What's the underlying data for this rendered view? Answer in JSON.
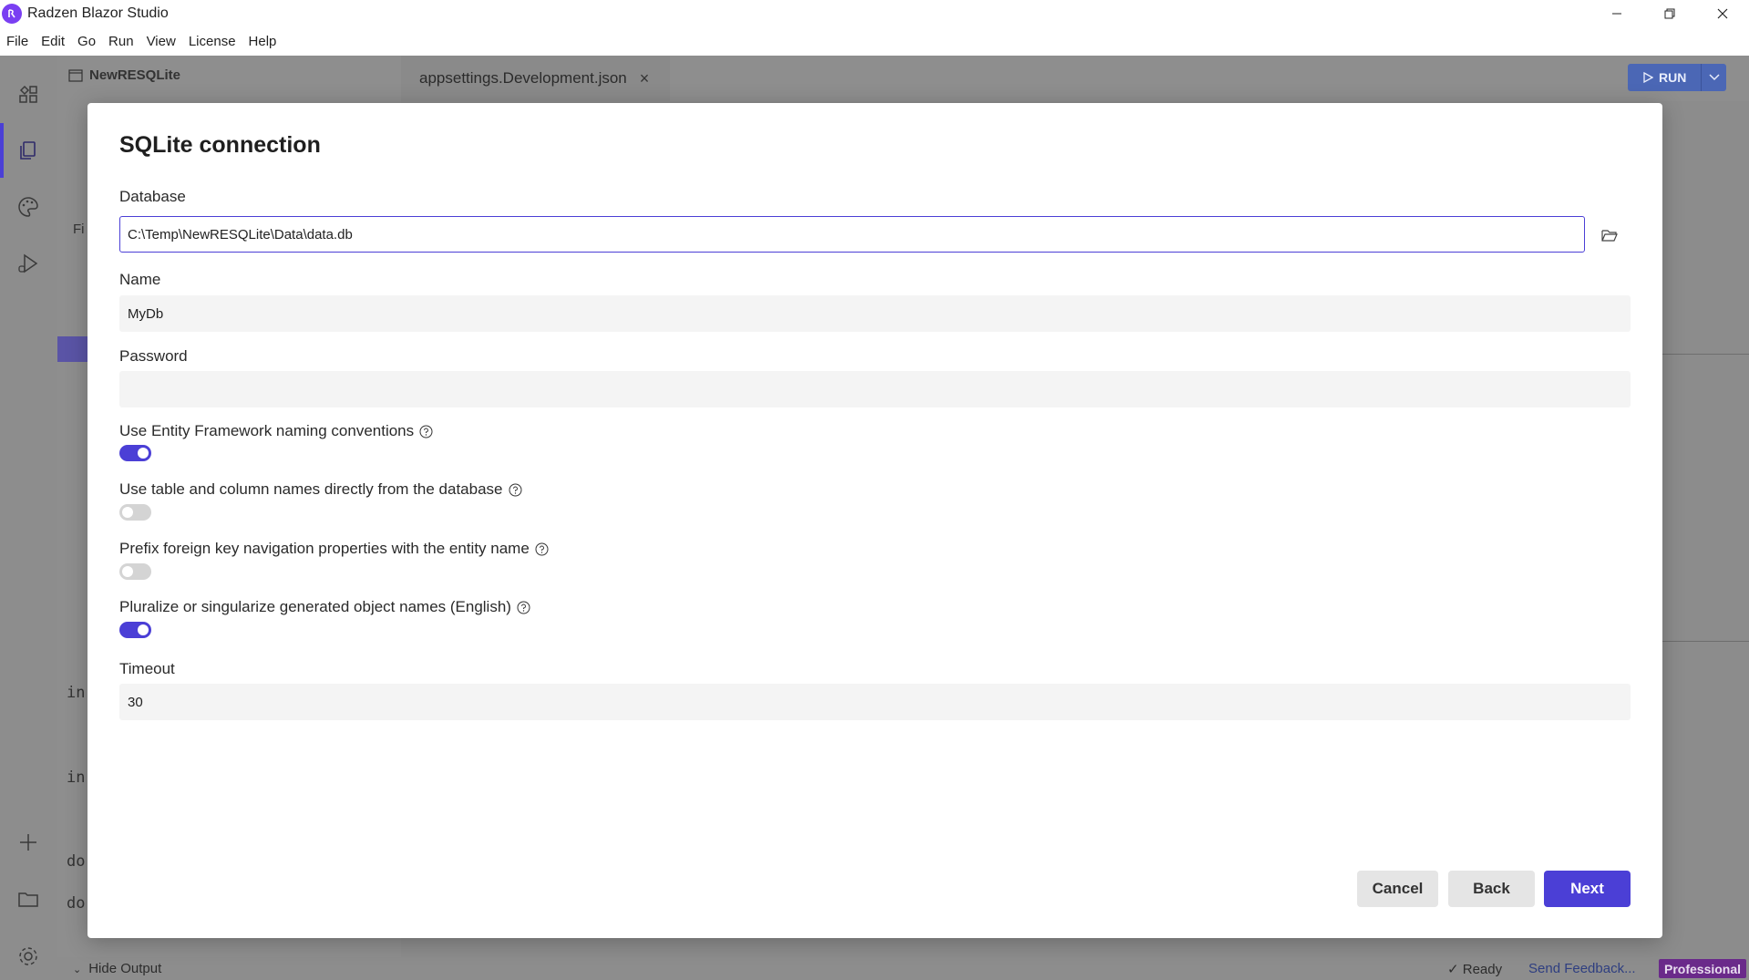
{
  "window": {
    "title": "Radzen Blazor Studio"
  },
  "menu": [
    "File",
    "Edit",
    "Go",
    "Run",
    "View",
    "License",
    "Help"
  ],
  "background": {
    "project_name": "NewRESQLite",
    "editor_tab": "appsettings.Development.json",
    "editor_tab_close": "×",
    "run_label": "RUN",
    "code_fragments": [
      "in",
      "in",
      "do",
      "do"
    ],
    "side_fragment": "Fi"
  },
  "dialog": {
    "title": "SQLite connection",
    "database": {
      "label": "Database",
      "value": "C:\\Temp\\NewRESQLite\\Data\\data.db"
    },
    "name": {
      "label": "Name",
      "value": "MyDb"
    },
    "password": {
      "label": "Password",
      "value": ""
    },
    "switches": [
      {
        "label": "Use Entity Framework naming conventions",
        "on": true
      },
      {
        "label": "Use table and column names directly from the database",
        "on": false
      },
      {
        "label": "Prefix foreign key navigation properties with the entity name",
        "on": false
      },
      {
        "label": "Pluralize or singularize generated object names (English)",
        "on": true
      }
    ],
    "timeout": {
      "label": "Timeout",
      "value": "30"
    },
    "buttons": {
      "cancel": "Cancel",
      "back": "Back",
      "next": "Next"
    }
  },
  "statusbar": {
    "hide_output": "Hide Output",
    "ready": "✓ Ready",
    "feedback": "Send Feedback...",
    "edition": "Professional"
  },
  "colors": {
    "accent": "#4b3fd6",
    "run_button": "#4b67b5",
    "edition_badge": "#6a2a8a"
  },
  "icons": {
    "activity": [
      "components-icon",
      "copy-files-icon",
      "palette-icon",
      "run-debug-icon",
      "plus-icon",
      "folder-icon",
      "gear-icon"
    ]
  }
}
